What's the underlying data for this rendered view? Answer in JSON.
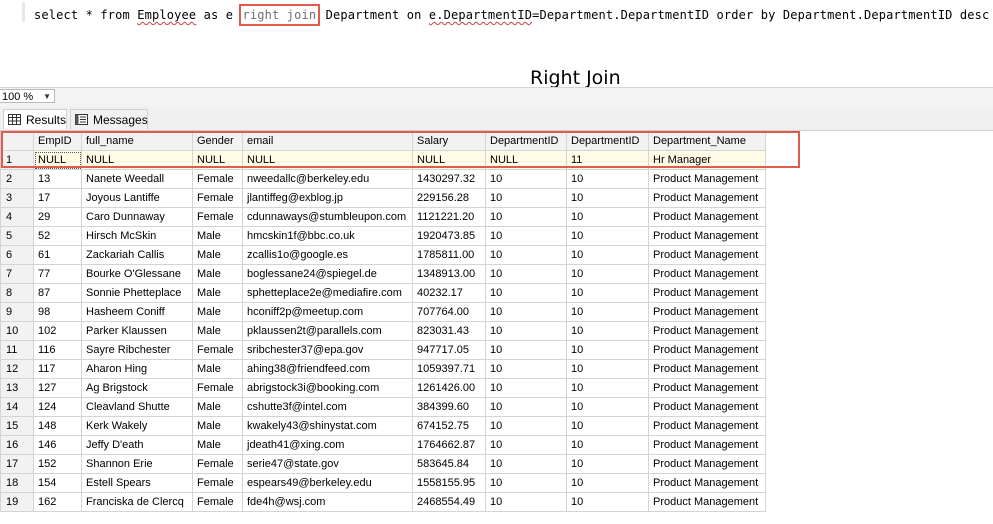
{
  "editor": {
    "query_before": "select * from ",
    "query_employee": "Employee",
    "query_mid": " as e ",
    "query_keyword": "right join",
    "query_after1": " Department on ",
    "query_edept": "e.DepartmentID",
    "query_after2": "=Department.DepartmentID order by Department.DepartmentID desc",
    "caption": "Right Join"
  },
  "zoom": {
    "value": "100 %"
  },
  "tabs": [
    {
      "label": "Results",
      "icon": "grid-icon"
    },
    {
      "label": "Messages",
      "icon": "messages-icon"
    }
  ],
  "grid": {
    "columns": [
      "",
      "EmpID",
      "full_name",
      "Gender",
      "email",
      "Salary",
      "DepartmentID",
      "DepartmentID",
      "Department_Name"
    ],
    "rows": [
      [
        "1",
        "NULL",
        "NULL",
        "NULL",
        "NULL",
        "NULL",
        "NULL",
        "11",
        "Hr Manager"
      ],
      [
        "2",
        "13",
        "Nanete Weedall",
        "Female",
        "nweedallc@berkeley.edu",
        "1430297.32",
        "10",
        "10",
        "Product Management"
      ],
      [
        "3",
        "17",
        "Joyous Lantiffe",
        "Female",
        "jlantiffeg@exblog.jp",
        "229156.28",
        "10",
        "10",
        "Product Management"
      ],
      [
        "4",
        "29",
        "Caro Dunnaway",
        "Female",
        "cdunnaways@stumbleupon.com",
        "1121221.20",
        "10",
        "10",
        "Product Management"
      ],
      [
        "5",
        "52",
        "Hirsch McSkin",
        "Male",
        "hmcskin1f@bbc.co.uk",
        "1920473.85",
        "10",
        "10",
        "Product Management"
      ],
      [
        "6",
        "61",
        "Zackariah Callis",
        "Male",
        "zcallis1o@google.es",
        "1785811.00",
        "10",
        "10",
        "Product Management"
      ],
      [
        "7",
        "77",
        "Bourke O'Glessane",
        "Male",
        "boglessane24@spiegel.de",
        "1348913.00",
        "10",
        "10",
        "Product Management"
      ],
      [
        "8",
        "87",
        "Sonnie Phetteplace",
        "Male",
        "sphetteplace2e@mediafire.com",
        "40232.17",
        "10",
        "10",
        "Product Management"
      ],
      [
        "9",
        "98",
        "Hasheem Coniff",
        "Male",
        "hconiff2p@meetup.com",
        "707764.00",
        "10",
        "10",
        "Product Management"
      ],
      [
        "10",
        "102",
        "Parker Klaussen",
        "Male",
        "pklaussen2t@parallels.com",
        "823031.43",
        "10",
        "10",
        "Product Management"
      ],
      [
        "11",
        "116",
        "Sayre Ribchester",
        "Female",
        "sribchester37@epa.gov",
        "947717.05",
        "10",
        "10",
        "Product Management"
      ],
      [
        "12",
        "117",
        "Aharon Hing",
        "Male",
        "ahing38@friendfeed.com",
        "1059397.71",
        "10",
        "10",
        "Product Management"
      ],
      [
        "13",
        "127",
        "Ag Brigstock",
        "Female",
        "abrigstock3i@booking.com",
        "1261426.00",
        "10",
        "10",
        "Product Management"
      ],
      [
        "14",
        "124",
        "Cleavland Shutte",
        "Male",
        "cshutte3f@intel.com",
        "384399.60",
        "10",
        "10",
        "Product Management"
      ],
      [
        "15",
        "148",
        "Kerk Wakely",
        "Male",
        "kwakely43@shinystat.com",
        "674152.75",
        "10",
        "10",
        "Product Management"
      ],
      [
        "16",
        "146",
        "Jeffy D'eath",
        "Male",
        "jdeath41@xing.com",
        "1764662.87",
        "10",
        "10",
        "Product Management"
      ],
      [
        "17",
        "152",
        "Shannon Erie",
        "Female",
        "serie47@state.gov",
        "583645.84",
        "10",
        "10",
        "Product Management"
      ],
      [
        "18",
        "154",
        "Estell Spears",
        "Female",
        "espears49@berkeley.edu",
        "1558155.95",
        "10",
        "10",
        "Product Management"
      ],
      [
        "19",
        "162",
        "Franciska de Clercq",
        "Female",
        "fde4h@wsj.com",
        "2468554.49",
        "10",
        "10",
        "Product Management"
      ]
    ]
  },
  "colors": {
    "highlight": "#e05a4e",
    "header_bg": "#f2f2f2",
    "null_row_bg": "#fffbe6"
  }
}
